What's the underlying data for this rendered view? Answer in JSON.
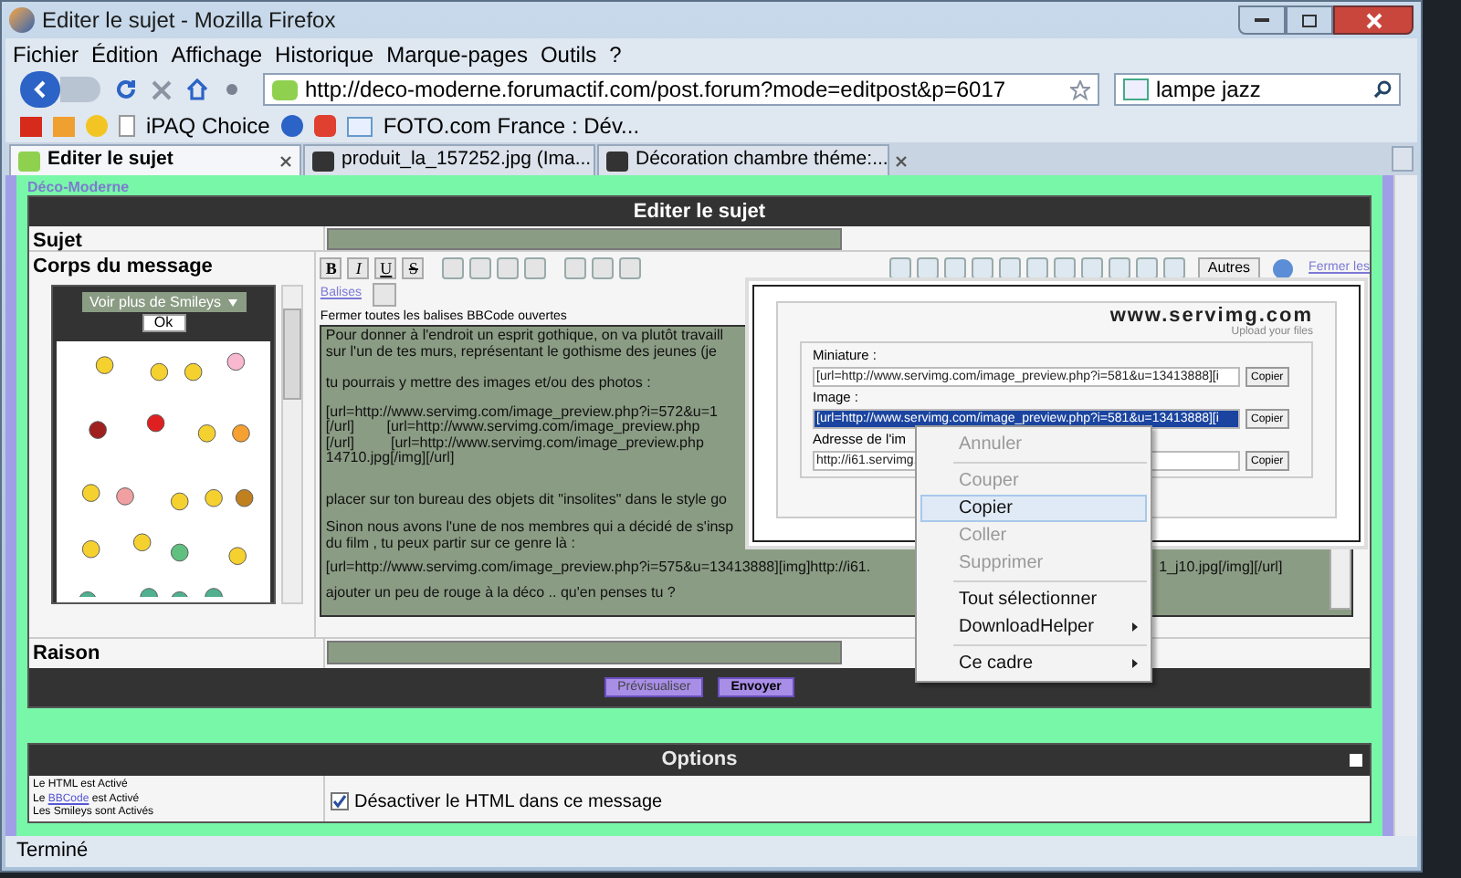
{
  "window": {
    "title": "Editer le sujet - Mozilla Firefox"
  },
  "menu": [
    "Fichier",
    "Édition",
    "Affichage",
    "Historique",
    "Marque-pages",
    "Outils",
    "?"
  ],
  "address": {
    "value": "http://deco-moderne.forumactif.com/post.forum?mode=editpost&p=6017"
  },
  "search": {
    "value": "lampe jazz"
  },
  "bookmarks": [
    "iPAQ Choice",
    "FOTO.com France : Dév..."
  ],
  "tabs": [
    {
      "label": "Editer le sujet",
      "selected": true
    },
    {
      "label": "produit_la_157252.jpg (Ima...",
      "selected": false
    },
    {
      "label": "Décoration chambre théme:...",
      "selected": false
    }
  ],
  "page": {
    "site_title": "Déco-Moderne",
    "form_title": "Editer le sujet",
    "subject_label": "Sujet",
    "body_label": "Corps du message",
    "smileys": {
      "dropdown": "Voir plus de Smileys",
      "ok": "Ok"
    },
    "format_buttons": [
      "B",
      "I",
      "U",
      "S"
    ],
    "autres": "Autres",
    "close_link": "Fermer les",
    "tags_link": "Balises",
    "close_tags": "Fermer toutes les balises BBCode ouvertes",
    "message_paragraphs": [
      [
        "Pour donner à l'endroit un esprit gothique, on va plutôt travaill",
        "sur l'un de tes murs, représentant le gothisme des jeunes (je"
      ],
      [
        "tu pourrais y mettre des images et/ou des photos :"
      ],
      [
        "[url=http://www.servimg.com/image_preview.php?i=572&u=1",
        "[/url]        [url=http://www.servimg.com/image_preview.php",
        "[/url]         [url=http://www.servimg.com/image_preview.php",
        "14710.jpg[/img][/url]"
      ],
      [
        "placer sur ton bureau des objets dit \"insolites\" dans le style go"
      ],
      [
        "Sinon nous avons l'une de nos membres qui a décidé de s'insp",
        "du film , tu peux partir sur ce genre là :"
      ]
    ],
    "covered_line": [
      "[url=http://www.servimg.com/image_preview.php?i=575&u=13413888][img]http://i61.",
      "1_j10.jpg[/img][/url]"
    ],
    "last_line": "ajouter un peu de rouge à la déco .. qu'en penses tu ?",
    "reason_label": "Raison",
    "buttons": [
      "Prévisualiser",
      "Envoyer"
    ]
  },
  "servimg_popup": {
    "logo": "www.servimg.com",
    "tagline": "Upload your files",
    "fields": [
      {
        "label": "Miniature :",
        "value": "[url=http://www.servimg.com/image_preview.php?i=581&u=13413888][i",
        "selected": false,
        "button": "Copier"
      },
      {
        "label": "Image :",
        "value": "[url=http://www.servimg.com/image_preview.php?i=581&u=13413888][i",
        "selected": true,
        "button": "Copier"
      },
      {
        "label": "Adresse de l'im",
        "value": "http://i61.servimg.",
        "selected": false,
        "button": "Copier"
      }
    ]
  },
  "context_menu": [
    {
      "kind": "item",
      "label": "Annuler",
      "disabled": true,
      "selected": false
    },
    {
      "kind": "separator"
    },
    {
      "kind": "item",
      "label": "Couper",
      "disabled": true,
      "selected": false
    },
    {
      "kind": "item",
      "label": "Copier",
      "disabled": false,
      "selected": true
    },
    {
      "kind": "item",
      "label": "Coller",
      "disabled": true,
      "selected": false
    },
    {
      "kind": "item",
      "label": "Supprimer",
      "disabled": true,
      "selected": false
    },
    {
      "kind": "separator"
    },
    {
      "kind": "item",
      "label": "Tout sélectionner",
      "disabled": false,
      "selected": false
    },
    {
      "kind": "submenu",
      "label": "DownloadHelper",
      "disabled": false,
      "selected": false
    },
    {
      "kind": "separator"
    },
    {
      "kind": "submenu",
      "label": "Ce cadre",
      "disabled": false,
      "selected": false
    }
  ],
  "options": {
    "title": "Options",
    "status_lines": [
      {
        "before": "Le HTML est Activé"
      },
      {
        "before": "Le ",
        "link": "BBCode",
        "after": " est Activé"
      },
      {
        "before": "Les Smileys sont Activés"
      }
    ],
    "checkbox": {
      "label": "Désactiver le HTML dans ce message",
      "checked": true
    }
  },
  "status_bar": "Terminé"
}
